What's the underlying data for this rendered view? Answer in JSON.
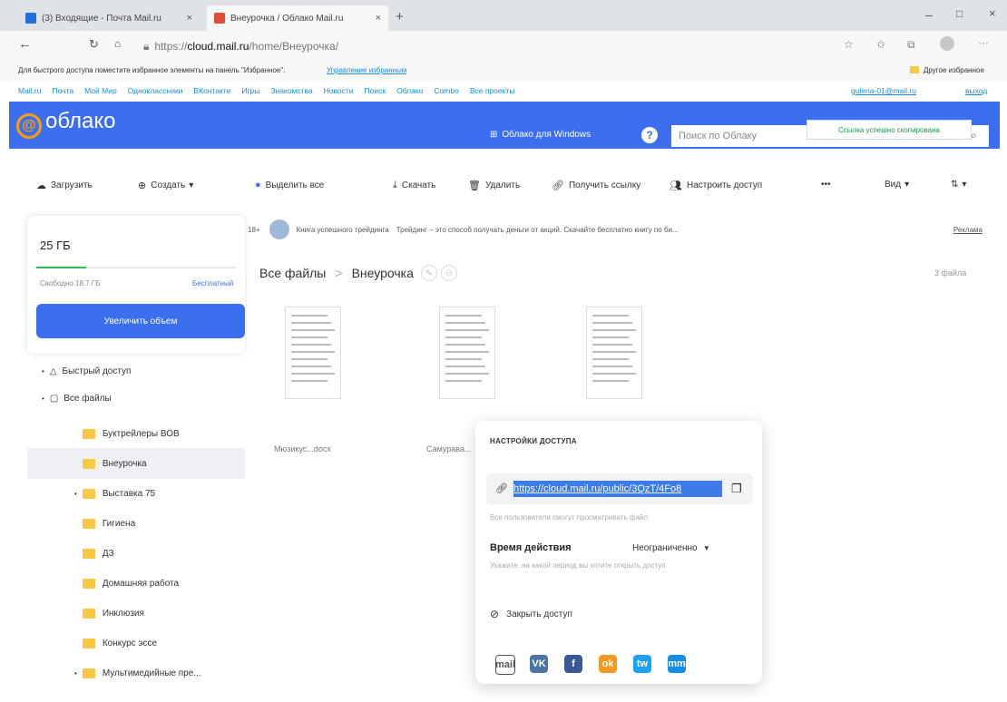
{
  "browser": {
    "tabs": [
      {
        "title": "(3) Входящие - Почта Mail.ru"
      },
      {
        "title": "Внеурочка / Облако Mail.ru"
      }
    ],
    "url_prefix": "https://",
    "url_domain": "cloud.mail.ru",
    "url_path": "/home/Внеурочка/",
    "favbar_hint": "Для быстрого доступа поместите избранное элементы на панель \"Избранное\".",
    "favbar_link": "Управление избранным",
    "favbar_other": "Другое избранное"
  },
  "portal": {
    "links": [
      "Mail.ru",
      "Почта",
      "Мой Мир",
      "Одноклассники",
      "ВКонтакте",
      "Игры",
      "Знакомства",
      "Новости",
      "Поиск",
      "Облако",
      "Combo",
      "Все проекты"
    ],
    "user": "gulena-01@mail.ru",
    "exit": "выход"
  },
  "header": {
    "logo": "облако",
    "windows_label": "Облако для Windows",
    "search_placeholder": "Поиск по Облаку"
  },
  "toast": "Ссылка успешно скопирована",
  "toolbar": {
    "upload": "Загрузить",
    "create": "Создать",
    "select_all": "Выделить все",
    "download": "Скачать",
    "delete": "Удалить",
    "get_link": "Получить ссылку",
    "access": "Настроить доступ",
    "more": "•••",
    "view": "Вид"
  },
  "storage": {
    "total": "25 ГБ",
    "free": "Свободно 18.7 ГБ",
    "plan": "Бесплатный",
    "used_fraction": 0.25,
    "increase": "Увеличить объем"
  },
  "nav": {
    "quick": "Быстрый доступ",
    "all": "Все файлы",
    "folders": [
      "Буктрейлеры ВОВ",
      "Внеурочка",
      "Выставка 75",
      "Гигиена",
      "ДЗ",
      "Домашняя работа",
      "Инклюзия",
      "Конкурс эссе",
      "Мультимедийные пре..."
    ]
  },
  "promo": {
    "age": "18+",
    "title": "Книга успешного трейдинга",
    "text": "Трейдинг – это способ получать деньги от акций. Скачайте бесплатно книгу по би...",
    "ad": "Реклама"
  },
  "breadcrumb": {
    "root": "Все файлы",
    "sep": ">",
    "current": "Внеурочка",
    "count": "3 файла"
  },
  "files": [
    {
      "name": "Мюзикус...docx"
    },
    {
      "name": "Самурава..."
    },
    {
      "name": ""
    }
  ],
  "popup": {
    "title": "НАСТРОЙКИ ДОСТУПА",
    "link": "https://cloud.mail.ru/public/3QzT/4Fo8",
    "hint": "Все пользователи смогут просматривать файл",
    "time_label": "Время действия",
    "time_value": "Неограниченно",
    "time_hint": "Укажите, на какой период вы хотите открыть доступ",
    "close_access": "Закрыть доступ",
    "socials": [
      "mail",
      "VK",
      "f",
      "ok",
      "tw",
      "mm"
    ]
  }
}
